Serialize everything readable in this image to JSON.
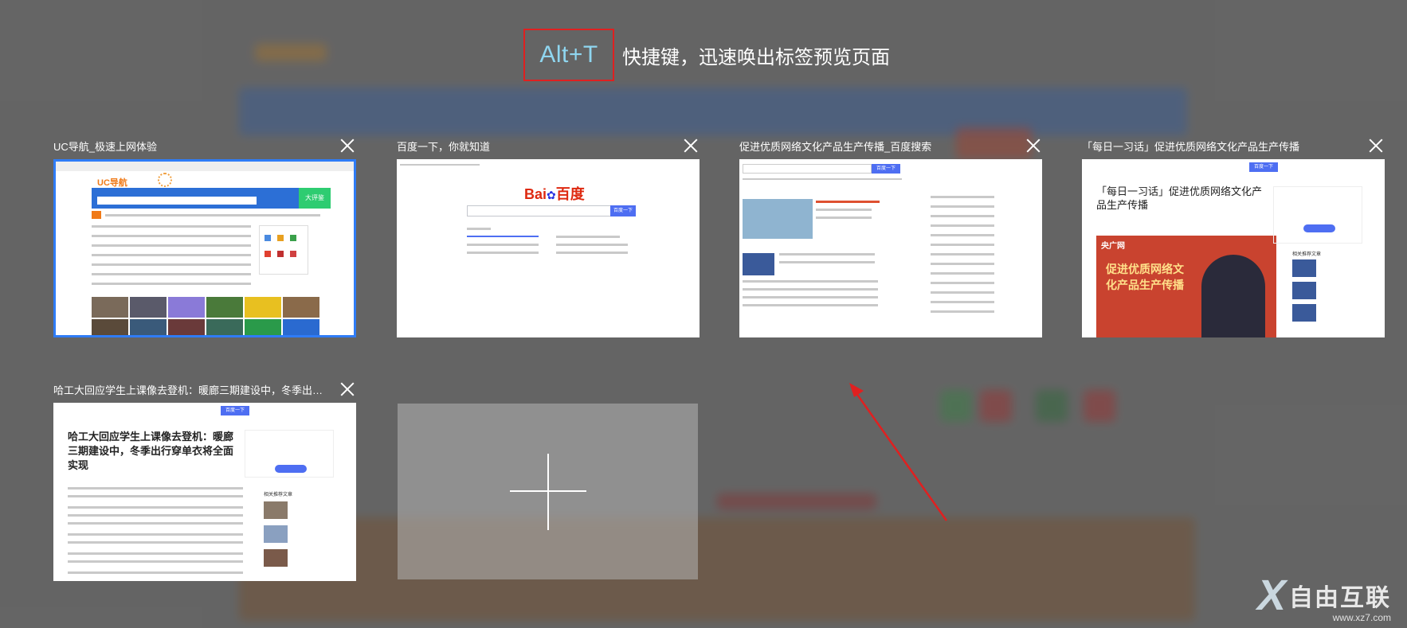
{
  "hint": {
    "key": "Alt+T",
    "text": "快捷键，迅速唤出标签预览页面"
  },
  "tabs": [
    {
      "title": "UC导航_极速上网体验",
      "active": true
    },
    {
      "title": "百度一下，你就知道",
      "active": false
    },
    {
      "title": "促进优质网络文化产品生产传播_百度搜索",
      "active": false
    },
    {
      "title": "「每日一习话」促进优质网络文化产品生产传播",
      "active": false
    },
    {
      "title": "哈工大回应学生上课像去登机：暖廊三期建设中，冬季出行穿单…",
      "active": false
    }
  ],
  "thumbs": {
    "uc": {
      "logo": "UC导航",
      "promo": "大评鉴"
    },
    "baidu": {
      "logo_en": "Bai",
      "logo_cn": "百度",
      "search_btn": "百度一下"
    },
    "search": {
      "search_btn": "百度一下"
    },
    "xi": {
      "search_btn": "百度一下",
      "headline": "「每日一习话」促进优质网络文化产品生产传播",
      "banner_brand": "央广网",
      "banner_text": "促进优质网络文化产品生产传播",
      "side_title": "相关推荐文章"
    },
    "hit": {
      "search_btn": "百度一下",
      "headline": "哈工大回应学生上课像去登机：暖廊三期建设中，冬季出行穿单衣将全面实现",
      "side_title": "相关推荐文章"
    }
  },
  "add_tab": {
    "icon": "plus-icon"
  },
  "watermark": {
    "brand": "自由互联",
    "url": "www.xz7.com"
  },
  "colors": {
    "highlight_border": "#e02020",
    "active_border": "#2f7cf6",
    "accent_blue": "#4e6ef2",
    "key_text": "#8fd6f0"
  }
}
